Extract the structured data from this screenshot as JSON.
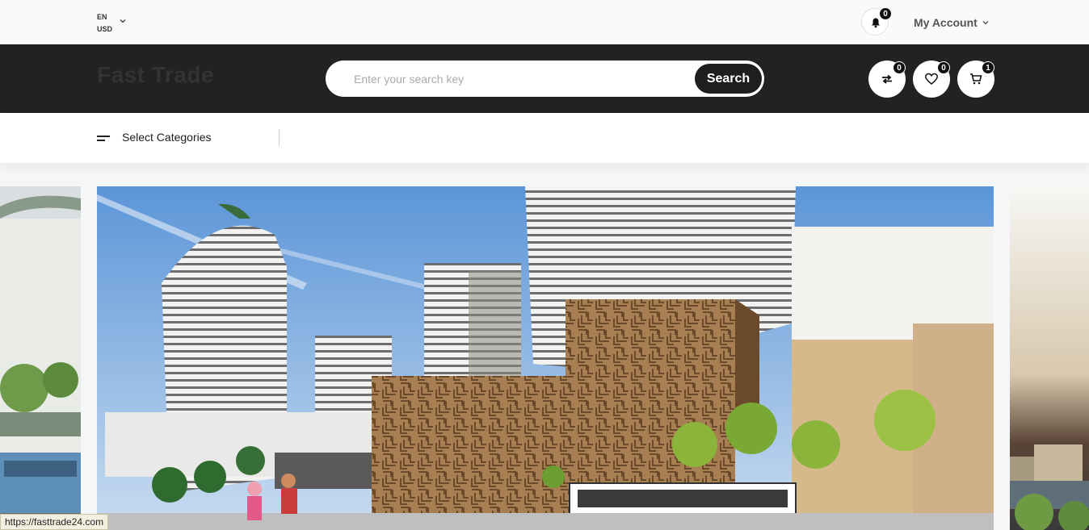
{
  "topbar": {
    "language": "EN",
    "currency": "USD",
    "notifications_count": "0",
    "account_label": "My Account"
  },
  "header": {
    "logo_text": "Fast Trade",
    "search_placeholder": "Enter your search key",
    "search_button": "Search",
    "compare_count": "0",
    "wishlist_count": "0",
    "cart_count": "1"
  },
  "categories": {
    "label": "Select Categories"
  },
  "status_bar": {
    "url": "https://fasttrade24.com"
  },
  "colors": {
    "header_bg": "#222222",
    "accent": "#1e1e1e"
  },
  "icons": [
    "chevron-down-icon",
    "bell-icon",
    "compare-icon",
    "heart-icon",
    "cart-icon",
    "menu-icon"
  ]
}
